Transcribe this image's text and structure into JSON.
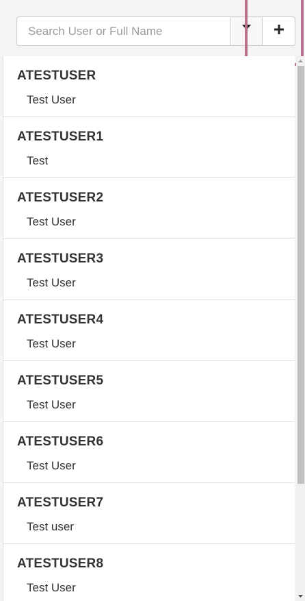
{
  "search": {
    "placeholder": "Search User or Full Name",
    "value": ""
  },
  "toolbar": {
    "filter_icon": "filter-icon",
    "add_icon": "plus-icon",
    "add_label": "+"
  },
  "users": [
    {
      "id": "ATESTUSER",
      "name": "Test User"
    },
    {
      "id": "ATESTUSER1",
      "name": "Test"
    },
    {
      "id": "ATESTUSER2",
      "name": "Test User"
    },
    {
      "id": "ATESTUSER3",
      "name": "Test User"
    },
    {
      "id": "ATESTUSER4",
      "name": "Test User"
    },
    {
      "id": "ATESTUSER5",
      "name": "Test User"
    },
    {
      "id": "ATESTUSER6",
      "name": "Test User"
    },
    {
      "id": "ATESTUSER7",
      "name": "Test user"
    },
    {
      "id": "ATESTUSER8",
      "name": "Test User"
    }
  ],
  "colors": {
    "highlight": "#b9708f",
    "text": "#333333",
    "filter_icon": "#222222"
  }
}
